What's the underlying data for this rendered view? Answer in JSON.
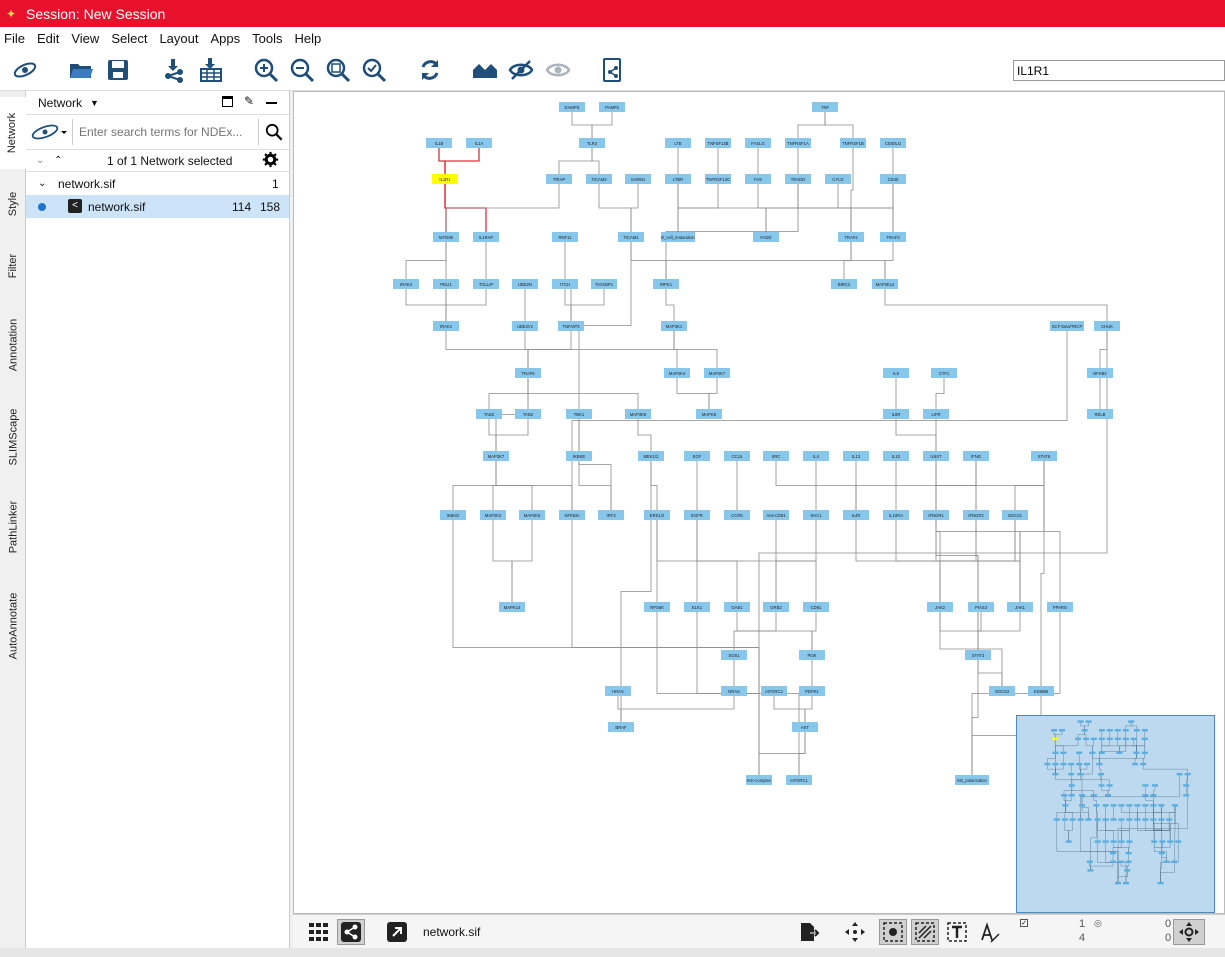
{
  "window": {
    "title": "Session: New Session"
  },
  "menu": [
    "File",
    "Edit",
    "View",
    "Select",
    "Layout",
    "Apps",
    "Tools",
    "Help"
  ],
  "search": {
    "value": "IL1R1"
  },
  "side_tabs": [
    "Network",
    "Style",
    "Filter",
    "Annotation",
    "SLIMScape",
    "PathLinker",
    "AutoAnnotate"
  ],
  "panel": {
    "title": "Network",
    "search_placeholder": "Enter search terms for NDEx...",
    "selection_text": "1 of 1 Network selected",
    "collection": {
      "name": "network.sif",
      "count": "1"
    },
    "network": {
      "name": "network.sif",
      "nodes": "114",
      "edges": "158"
    }
  },
  "bottom": {
    "network_name": "network.sif",
    "counts": {
      "selected_nodes": "1",
      "total_nodes": "4",
      "hidden_a": "0",
      "hidden_b": "0"
    }
  },
  "colors": {
    "title_bar": "#e8112d",
    "node_fill": "#87c7ec",
    "selected_node": "#ffff00",
    "selected_edge": "#e0303a",
    "minimap_fill": "#bcd9f0"
  },
  "graph": {
    "nodes": [
      "DAMPS",
      "PAMPs",
      "TNF",
      "IL1B",
      "IL1A",
      "TLR4",
      "LTB",
      "TNFSF13B",
      "FASLG",
      "TNFRSF1A",
      "TNFRSF1B",
      "CD40LG",
      "IL1R1",
      "TIRAP",
      "TICAM2",
      "SARM1",
      "LTBR",
      "TNFRSF13C",
      "FAS",
      "TRADD",
      "CYLD",
      "CD40",
      "MYD88",
      "IL1RAP",
      "RNF11",
      "TICAM1",
      "B_cell_maturation",
      "FADD",
      "TRAF2",
      "TRAF3",
      "IRAK4",
      "PELI1",
      "TOLLIP",
      "UBE2N",
      "ITCH",
      "TAX1BP1",
      "RIPK1",
      "BIRC2",
      "MAP3K14",
      "IRAK1",
      "UBE2V1",
      "TNFAIP3",
      "MAP3K1",
      "SCF-beta/TRCP",
      "CHUK",
      "TRAF6",
      "MAP2K4",
      "MAP2K7",
      "IL6",
      "CTF1",
      "NFKB2",
      "TAB3",
      "TAB2",
      "TBK1",
      "MAP3K8",
      "MAPK8",
      "IL6R",
      "LIFR",
      "RELB",
      "MAP3K7",
      "IKBKE",
      "MEK1/2",
      "EGF",
      "CCL5",
      "SRC",
      "IL4",
      "IL13",
      "IL10",
      "IL6ST",
      "IFNG",
      "STAT6",
      "IKBKG",
      "MAP2K3",
      "MAP2K6",
      "NFKBIA",
      "IRF3",
      "ERK1/2",
      "EGFR",
      "CCR5",
      "Anti-CD81",
      "SHC1",
      "IL4R",
      "IL10RA",
      "IFNGR1",
      "IFNGR2",
      "SOCS1",
      "MAPK14",
      "RPS6K",
      "ELK1",
      "GAB1",
      "GRB2",
      "CD81",
      "JAK2",
      "PIAS3",
      "JAK1",
      "PPARG",
      "SOS1",
      "PI3K",
      "STAT3",
      "HRAS",
      "NRAS",
      "mTORC2",
      "PDPK1",
      "SOCS3",
      "KDM6B",
      "BRAF",
      "AKT",
      "IKK-complex",
      "mTORC1",
      "M2_polarization"
    ]
  }
}
